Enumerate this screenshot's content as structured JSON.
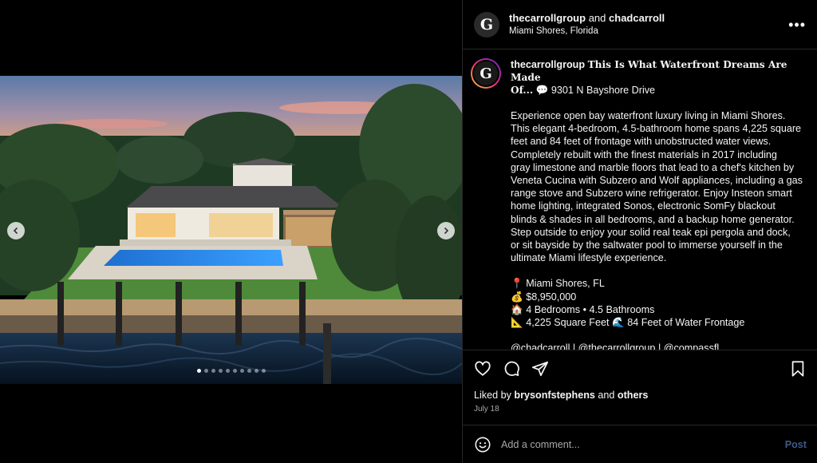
{
  "header": {
    "user1": "thecarrollgroup",
    "and_text": "and",
    "user2": "chadcarroll",
    "location": "Miami Shores, Florida",
    "avatar_letter": "G",
    "more_label": "•••"
  },
  "media": {
    "slide_count": 10,
    "active_slide": 1
  },
  "caption": {
    "username": "thecarrollgroup",
    "headline_1": "This Is What Waterfront Dreams Are Made",
    "headline_2": "Of...",
    "address_emoji": "💬",
    "address": "9301 N Bayshore Drive",
    "body_lines": [
      "Experience open bay waterfront luxury living in Miami Shores.",
      "This elegant 4-bedroom, 4.5-bathroom home spans 4,225 square",
      "feet and 84 feet of frontage with unobstructed water views.",
      "Completely rebuilt with the finest materials in 2017 including",
      "gray limestone and marble floors that lead to a chef's kitchen by",
      "Veneta Cucina with Subzero and Wolf appliances, including a gas",
      "range stove and Subzero wine refrigerator. Enjoy Insteon smart",
      "home lighting, integrated Sonos, electronic SomFy blackout",
      "blinds & shades in all bedrooms, and a backup home generator.",
      "Step outside to enjoy your solid real teak epi pergola and dock,",
      "or sit bayside by the saltwater pool to immerse yourself in the",
      "ultimate Miami lifestyle experience."
    ],
    "facts": [
      {
        "emoji": "📍",
        "text": "Miami Shores, FL"
      },
      {
        "emoji": "💰",
        "text": "$8,950,000"
      },
      {
        "emoji": "🏠",
        "text": "4 Bedrooms • 4.5 Bathrooms"
      },
      {
        "emoji": "📐",
        "text": "4,225 Square Feet 🌊 84 Feet of Water Frontage"
      }
    ],
    "mentions": "@chadcarroll | @thecarrollgroup | @compassfl"
  },
  "likes": {
    "prefix": "Liked by",
    "user": "brysonfstephens",
    "and_text": "and",
    "others": "others"
  },
  "date": "July 18",
  "comment": {
    "placeholder": "Add a comment...",
    "post_label": "Post"
  },
  "colors": {
    "background": "#000000",
    "divider": "#262626",
    "post_disabled": "#3e5a8a"
  }
}
